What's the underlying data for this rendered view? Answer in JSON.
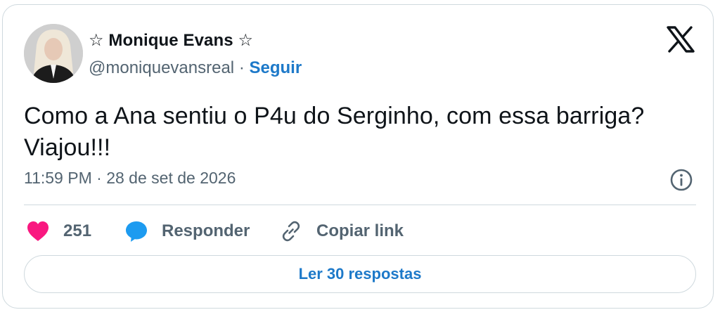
{
  "author": {
    "display_name": "☆ Monique Evans ☆",
    "handle": "@moniquevansreal",
    "separator": "·",
    "follow_label": "Seguir"
  },
  "tweet": {
    "text": "Como a Ana sentiu o P4u do Serginho, com essa barriga? Viajou!!!",
    "time": "11:59 PM",
    "date_separator": "·",
    "date": "28 de set de 2026"
  },
  "actions": {
    "like_count": "251",
    "reply_label": "Responder",
    "copy_link_label": "Copiar link"
  },
  "replies_button_label": "Ler 30 respostas",
  "colors": {
    "accent": "#1d79c9",
    "like": "#f91880",
    "reply_icon": "#1d9bf0",
    "muted": "#536471",
    "border": "#cfd9de"
  },
  "icons": [
    "x-logo-icon",
    "info-icon",
    "heart-icon",
    "reply-bubble-icon",
    "link-icon"
  ]
}
